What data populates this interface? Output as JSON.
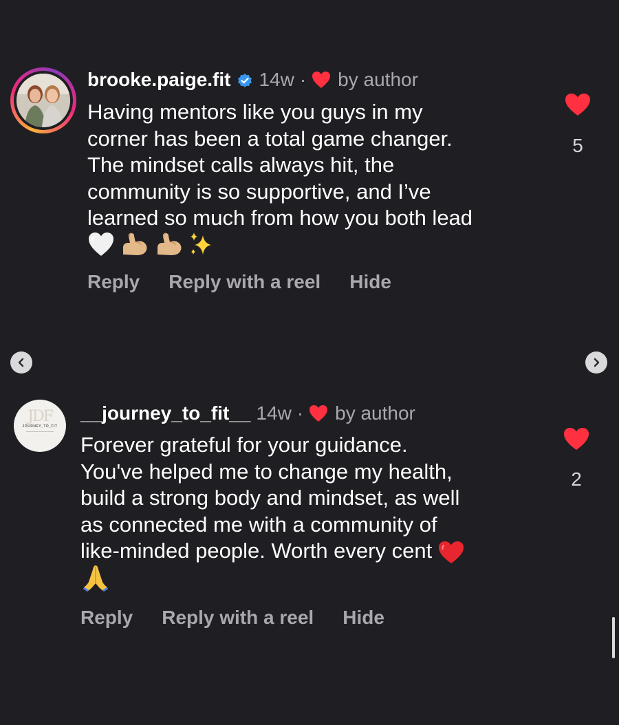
{
  "comments": [
    {
      "username": "brooke.paige.fit",
      "verified": true,
      "time": "14w",
      "separator": "·",
      "liked_by": "by author",
      "text": "Having mentors like you guys in my\ncorner has been a total game changer.\nThe mindset calls always hit, the\ncommunity is so supportive, and I’ve\nlearned so much from how you both lead",
      "emojis": [
        "white-heart-emoji",
        "flexed-biceps-emoji",
        "flexed-biceps-emoji",
        "sparkles-emoji"
      ],
      "like_count": "5",
      "actions": {
        "reply": "Reply",
        "reply_reel": "Reply with a reel",
        "hide": "Hide"
      }
    },
    {
      "username": "__journey_to_fit__",
      "verified": false,
      "time": "14w",
      "separator": "·",
      "liked_by": "by author",
      "text": "Forever grateful for your guidance.\nYou've helped me to change my health,\nbuild a strong body and mindset, as well\nas connected me with a community of\nlike-minded people. Worth every cent",
      "emojis": [
        "folded-hands-emoji"
      ],
      "trailing_emoji": "red-heart-emoji",
      "like_count": "2",
      "avatar_logo": {
        "mark": "JDF",
        "name": "JOURNEY_TO_FIT"
      },
      "actions": {
        "reply": "Reply",
        "reply_reel": "Reply with a reel",
        "hide": "Hide"
      }
    }
  ],
  "colors": {
    "background": "#1f1e22",
    "text": "#ffffff",
    "muted": "#a8a8ad",
    "heart": "#ff3040",
    "verified": "#3897f0"
  }
}
